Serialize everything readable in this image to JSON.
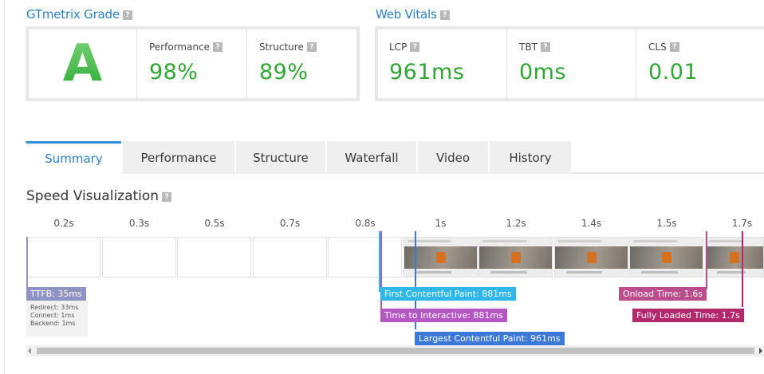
{
  "grade": {
    "title": "GTmetrix Grade",
    "help": "?",
    "letter": "A",
    "performance": {
      "label": "Performance",
      "value": "98%"
    },
    "structure": {
      "label": "Structure",
      "value": "89%"
    }
  },
  "vitals": {
    "title": "Web Vitals",
    "help": "?",
    "lcp": {
      "label": "LCP",
      "value": "961ms"
    },
    "tbt": {
      "label": "TBT",
      "value": "0ms"
    },
    "cls": {
      "label": "CLS",
      "value": "0.01"
    }
  },
  "tabs": [
    "Summary",
    "Performance",
    "Structure",
    "Waterfall",
    "Video",
    "History"
  ],
  "active_tab": "Summary",
  "speed_visualization": {
    "title": "Speed Visualization",
    "help": "?",
    "ticks": [
      "0.2s",
      "0.3s",
      "0.5s",
      "0.7s",
      "0.8s",
      "1s",
      "1.2s",
      "1.4s",
      "1.5s",
      "1.7s"
    ],
    "markers": {
      "ttfb": "TTFB: 35ms",
      "fcp": "First Contentful Paint: 881ms",
      "tti": "Time to Interactive: 881ms",
      "lcp": "Largest Contentful Paint: 961ms",
      "onload": "Onload Time: 1.6s",
      "fully_loaded": "Fully Loaded Time: 1.7s"
    },
    "ttfb_breakdown": [
      "Redirect: 33ms",
      "Connect: 1ms",
      "Backend: 1ms"
    ]
  },
  "colors": {
    "accent": "#2f7fc1",
    "grade_green": "#32a536",
    "ttfb": "#8f93c4",
    "fcp": "#2fb7ea",
    "tti": "#b358c2",
    "lcp": "#3c78d8",
    "onload": "#bb4d8d",
    "fully_loaded": "#b3286a"
  }
}
